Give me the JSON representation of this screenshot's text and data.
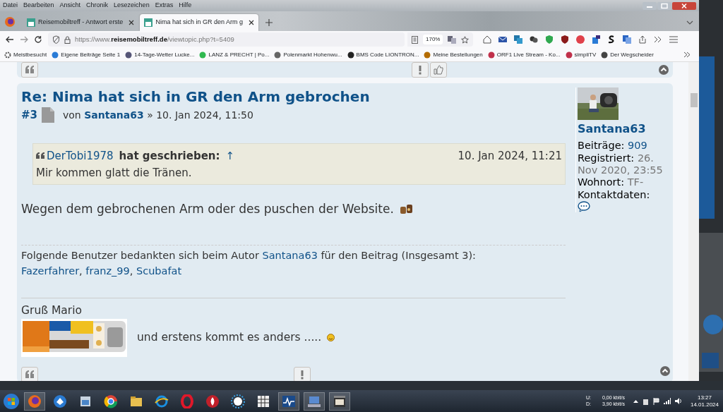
{
  "menu_bar": [
    "Datei",
    "Bearbeiten",
    "Ansicht",
    "Chronik",
    "Lesezeichen",
    "Extras",
    "Hilfe"
  ],
  "tabs": [
    {
      "label": "Reisemobiltreff - Antwort erste",
      "selected": false
    },
    {
      "label": "Nima hat sich in GR den Arm g",
      "selected": true
    }
  ],
  "address_bar": {
    "url_prefix": "https://www.",
    "domain": "reisemobiltreff.de",
    "path": "/viewtopic.php?t=5409",
    "zoom": "170%"
  },
  "bookmarks": [
    "Meistbesucht",
    "Eigene Beiträge Seite 1",
    "14-Tage-Wetter Lucke...",
    "LANZ & PRECHT | Po...",
    "Polenmarkt Hohenwu...",
    "BMS Code LIONTRON...",
    "Meine Bestellungen",
    "ORF1 Live Stream - Ko...",
    "simpliTV",
    "Der Wegscheider"
  ],
  "post": {
    "title": "Re: Nima hat sich in GR den Arm gebrochen",
    "number": "#3",
    "by": "von",
    "author": "Santana63",
    "date_sep": "»",
    "date": "10. Jan 2024, 11:50",
    "quote": {
      "author": "DerTobi1978",
      "suffix": "hat geschrieben:",
      "arrow": "↑",
      "date": "10. Jan 2024, 11:21",
      "text": "Mir kommen glatt die Tränen."
    },
    "body": "Wegen dem gebrochenen Arm oder des puschen der Website.",
    "thanks": {
      "before": "Folgende Benutzer bedankten sich beim Autor",
      "author": "Santana63",
      "after": "für den Beitrag (Insgesamt 3):",
      "users": [
        "Fazerfahrer",
        "franz_99",
        "Scubafat"
      ],
      "separator": ","
    },
    "signature": {
      "greeting": "Gruß Mario",
      "text": "und erstens kommt es anders ....."
    }
  },
  "profile": {
    "name": "Santana63",
    "fields": [
      {
        "label": "Beiträge:",
        "value": "909",
        "kind": "link"
      },
      {
        "label": "Registriert:",
        "value": "26. Nov 2020, 23:55",
        "kind": "muted"
      },
      {
        "label": "Wohnort:",
        "value": "TF-",
        "kind": "muted"
      },
      {
        "label": "Kontaktdaten:",
        "kind": "contact"
      }
    ]
  },
  "taskbar": {
    "upload_label": "U:",
    "upload": "0,00 kbit/s",
    "download_label": "D:",
    "download": "3,90 kbit/s",
    "time": "13:27",
    "date": "14.01.2024"
  }
}
